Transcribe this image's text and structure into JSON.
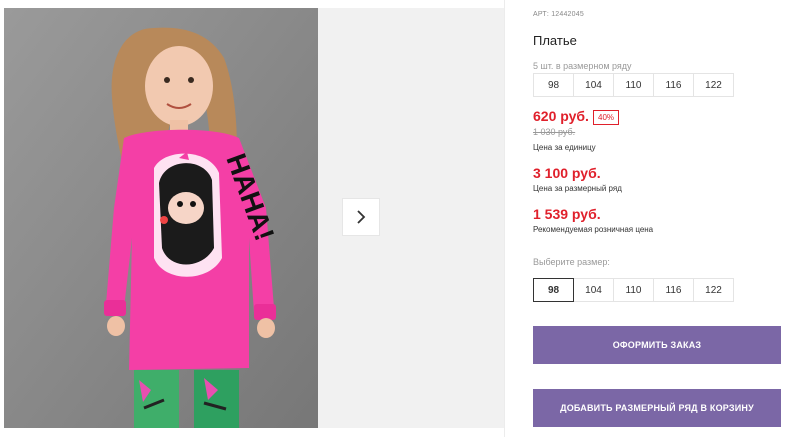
{
  "product": {
    "sku": "АРТ: 12442045",
    "title": "Платье",
    "range_label": "5 шт. в размерном ряду",
    "range_sizes": [
      "98",
      "104",
      "110",
      "116",
      "122"
    ],
    "discount_badge": "40%",
    "old_price": "1 030 руб."
  },
  "prices": {
    "unit_price": "620 руб.",
    "unit_caption": "Цена за единицу",
    "range_price": "3 100 руб.",
    "range_caption": "Цена за размерный ряд",
    "retail_price": "1 539 руб.",
    "retail_caption": "Рекомендуемая розничная цена"
  },
  "size_picker": {
    "label": "Выберите размер:",
    "sizes": [
      "98",
      "104",
      "110",
      "116",
      "122"
    ],
    "selected": "98"
  },
  "actions": {
    "order_label": "ОФОРМИТЬ ЗАКАЗ",
    "add_range_label": "ДОБАВИТЬ РАЗМЕРНЫЙ РЯД В КОРЗИНУ"
  },
  "gallery": {
    "next_icon": "chevron-right-icon",
    "print_text": "HAHA!"
  },
  "colors": {
    "accent": "#7b67a6",
    "price_red": "#e0202b",
    "dress_pink": "#f43fa6"
  }
}
